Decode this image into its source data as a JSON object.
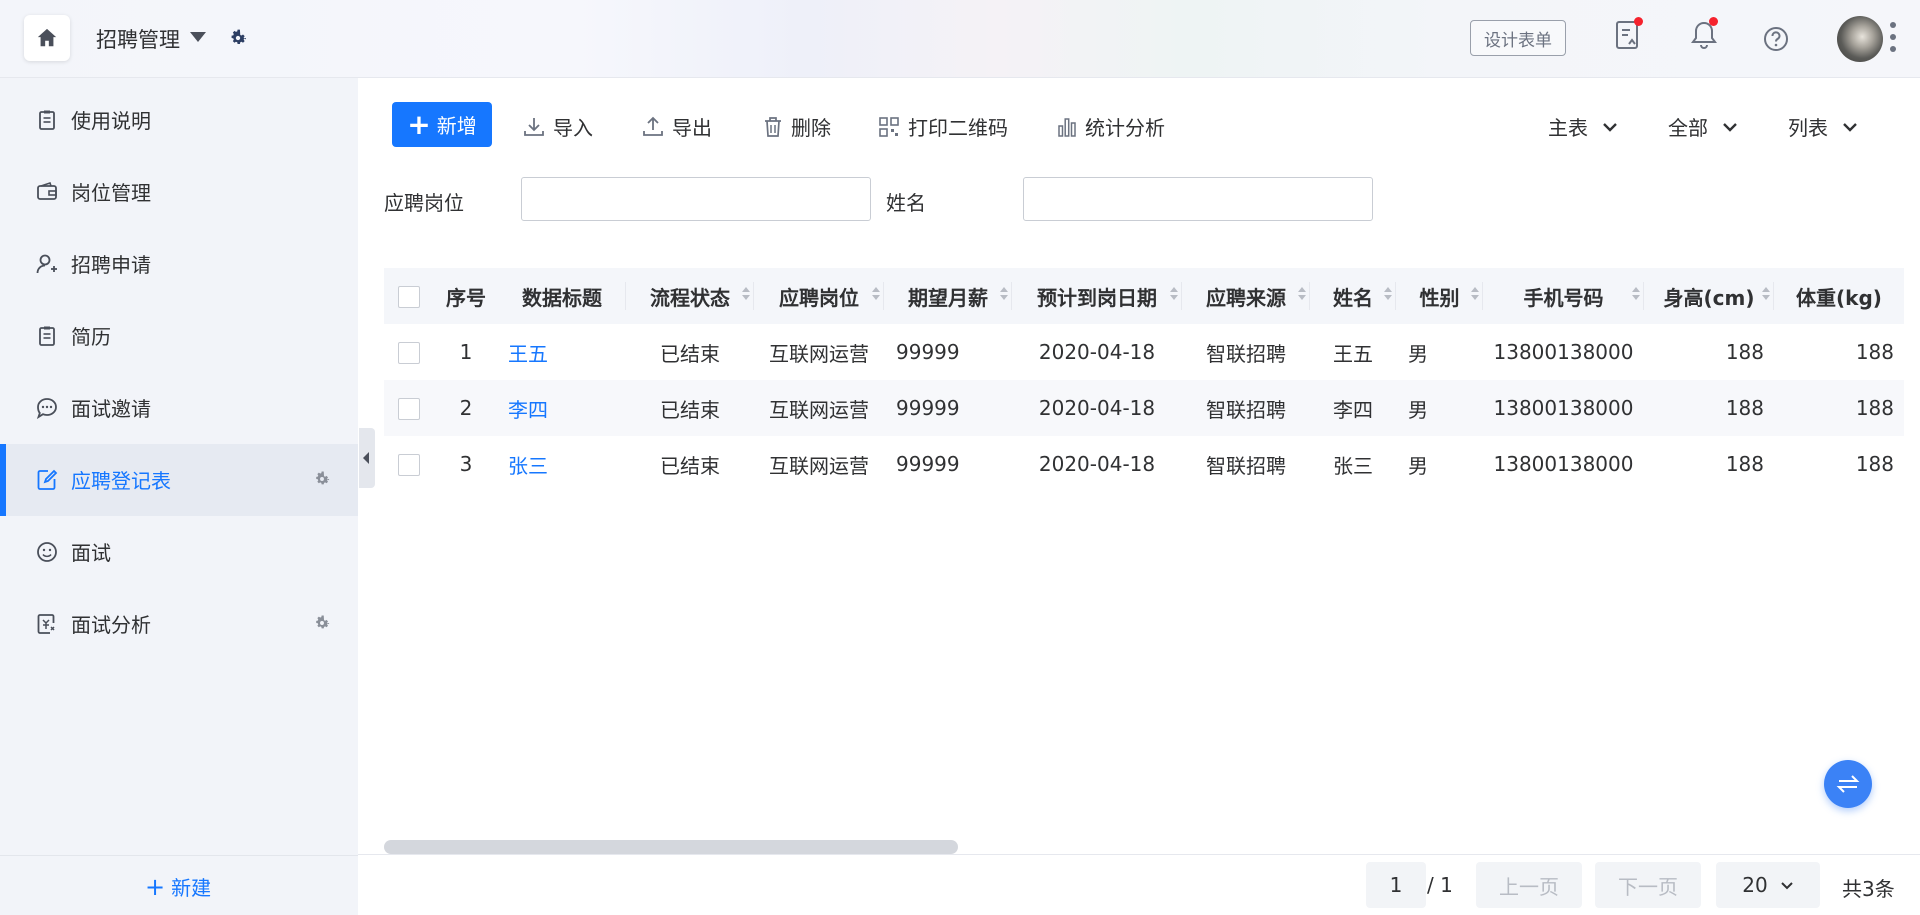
{
  "header": {
    "app_title": "招聘管理",
    "design_form_label": "设计表单"
  },
  "sidebar": {
    "items": [
      {
        "label": "使用说明",
        "icon": "clipboard-icon"
      },
      {
        "label": "岗位管理",
        "icon": "wallet-icon"
      },
      {
        "label": "招聘申请",
        "icon": "user-add-icon"
      },
      {
        "label": "简历",
        "icon": "clipboard-icon"
      },
      {
        "label": "面试邀请",
        "icon": "chat-icon"
      },
      {
        "label": "应聘登记表",
        "icon": "edit-doc-icon",
        "active": true
      },
      {
        "label": "面试",
        "icon": "smile-icon"
      },
      {
        "label": "面试分析",
        "icon": "report-icon"
      }
    ],
    "new_label": "新建"
  },
  "toolbar": {
    "add_label": "新增",
    "import_label": "导入",
    "export_label": "导出",
    "delete_label": "删除",
    "print_qr_label": "打印二维码",
    "stats_label": "统计分析",
    "view_main": "主表",
    "view_scope": "全部",
    "view_mode": "列表"
  },
  "filters": {
    "position_label": "应聘岗位",
    "position_value": "",
    "name_label": "姓名",
    "name_value": ""
  },
  "table": {
    "columns": [
      "序号",
      "数据标题",
      "流程状态",
      "应聘岗位",
      "期望月薪",
      "预计到岗日期",
      "应聘来源",
      "姓名",
      "性别",
      "手机号码",
      "身高(cm)",
      "体重(kg)"
    ],
    "rows": [
      {
        "index": "1",
        "title": "王五",
        "status": "已结束",
        "position": "互联网运营",
        "salary": "99999",
        "date": "2020-04-18",
        "source": "智联招聘",
        "name": "王五",
        "gender": "男",
        "phone": "13800138000",
        "height": "188",
        "weight": "188"
      },
      {
        "index": "2",
        "title": "李四",
        "status": "已结束",
        "position": "互联网运营",
        "salary": "99999",
        "date": "2020-04-18",
        "source": "智联招聘",
        "name": "李四",
        "gender": "男",
        "phone": "13800138000",
        "height": "188",
        "weight": "188"
      },
      {
        "index": "3",
        "title": "张三",
        "status": "已结束",
        "position": "互联网运营",
        "salary": "99999",
        "date": "2020-04-18",
        "source": "智联招聘",
        "name": "张三",
        "gender": "男",
        "phone": "13800138000",
        "height": "188",
        "weight": "188"
      }
    ]
  },
  "pagination": {
    "current_page": "1",
    "total_pages": "/ 1",
    "prev_label": "上一页",
    "next_label": "下一页",
    "page_size": "20",
    "total_count": "共3条"
  },
  "colors": {
    "accent": "#1677ff",
    "sidebar_bg": "#f2f4f9",
    "notification_dot": "#f5222d"
  }
}
